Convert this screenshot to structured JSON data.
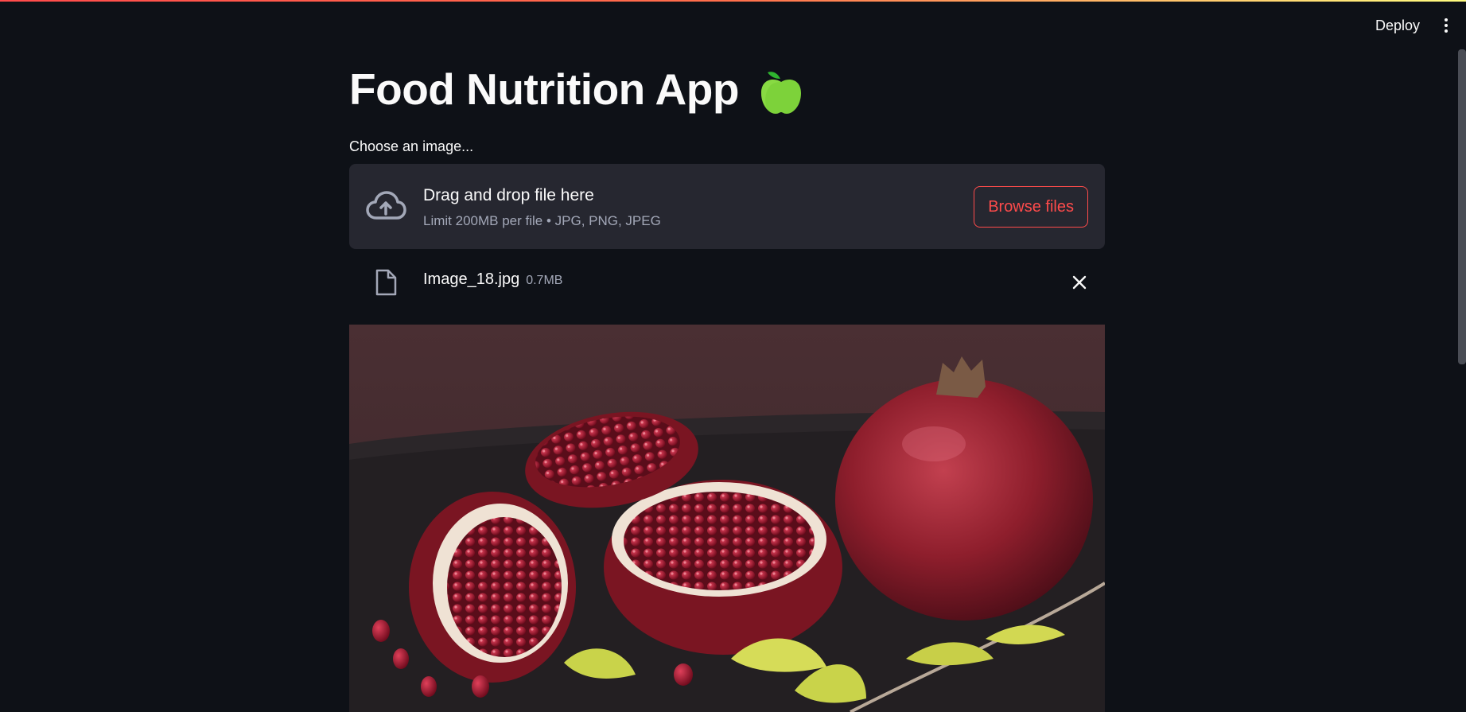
{
  "header": {
    "deploy_label": "Deploy",
    "menu_icon": "kebab-menu-icon"
  },
  "page": {
    "title": "Food Nutrition App",
    "title_icon": "green-apple-icon"
  },
  "uploader": {
    "label": "Choose an image...",
    "drop_title": "Drag and drop file here",
    "drop_subtitle": "Limit 200MB per file • JPG, PNG, JPEG",
    "browse_label": "Browse files",
    "upload_icon": "cloud-upload-icon"
  },
  "uploaded_file": {
    "name": "Image_18.jpg",
    "size": "0.7MB",
    "icon": "file-icon",
    "remove_icon": "close-icon"
  },
  "colors": {
    "background": "#0e1117",
    "surface": "#262730",
    "accent": "#ff4b4b",
    "text": "#fafafa",
    "muted_text": "#a3a8b8"
  }
}
